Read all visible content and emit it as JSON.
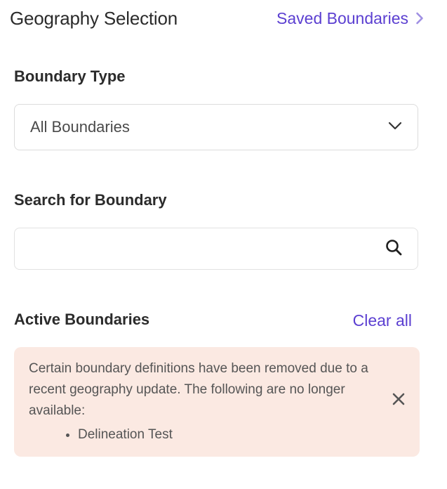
{
  "header": {
    "title": "Geography Selection",
    "saved_link_label": "Saved Boundaries"
  },
  "boundary_type": {
    "label": "Boundary Type",
    "selected_value": "All Boundaries"
  },
  "search": {
    "label": "Search for Boundary",
    "value": "",
    "placeholder": ""
  },
  "active_boundaries": {
    "label": "Active Boundaries",
    "clear_all_label": "Clear all"
  },
  "alert": {
    "message": "Certain boundary definitions have been removed due to a recent geography update. The following are no longer available:",
    "removed_items": [
      "Delineation Test"
    ]
  },
  "colors": {
    "accent": "#5b3fd1",
    "alert_bg": "#fbe9e2",
    "text": "#2b2b2b",
    "border": "#dcdcdc"
  },
  "icons": {
    "saved_link": "chevron-right-icon",
    "select": "chevron-down-icon",
    "search": "search-icon",
    "alert_close": "close-icon"
  }
}
